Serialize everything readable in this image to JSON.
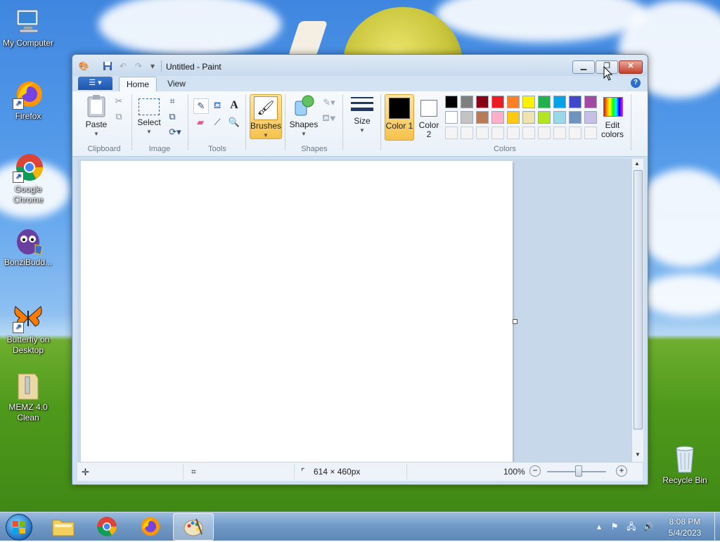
{
  "desktop": {
    "icons": [
      {
        "label": "My Computer"
      },
      {
        "label": "Firefox"
      },
      {
        "label": "Google Chrome"
      },
      {
        "label": "BonziBudd..."
      },
      {
        "label": "Butterfly on Desktop"
      },
      {
        "label": "MEMZ 4.0 Clean"
      },
      {
        "label": "Recycle Bin"
      }
    ]
  },
  "window": {
    "title": "Untitled - Paint",
    "tabs": [
      {
        "label": "Home"
      },
      {
        "label": "View"
      }
    ],
    "ribbon": {
      "clipboard": {
        "paste": "Paste",
        "group": "Clipboard"
      },
      "image": {
        "select": "Select",
        "group": "Image"
      },
      "tools": {
        "group": "Tools"
      },
      "brushes": {
        "label": "Brushes"
      },
      "shapes": {
        "label": "Shapes",
        "group": "Shapes"
      },
      "size": {
        "label": "Size"
      },
      "colors": {
        "color1": "Color 1",
        "color2": "Color 2",
        "color1_value": "#000000",
        "color2_value": "#ffffff",
        "edit": "Edit colors",
        "group": "Colors",
        "palette": [
          "#000000",
          "#7f7f7f",
          "#880015",
          "#ed1c24",
          "#ff7f27",
          "#fff200",
          "#22b14c",
          "#00a2e8",
          "#3f48cc",
          "#a349a4",
          "#ffffff",
          "#c3c3c3",
          "#b97a57",
          "#ffaec9",
          "#ffc90e",
          "#efe4b0",
          "#b5e61d",
          "#99d9ea",
          "#7092be",
          "#c8bfe7"
        ]
      }
    },
    "status": {
      "size": "614 × 460px",
      "zoom": "100%"
    }
  },
  "taskbar": {
    "time": "8:08 PM",
    "date": "5/4/2023"
  }
}
